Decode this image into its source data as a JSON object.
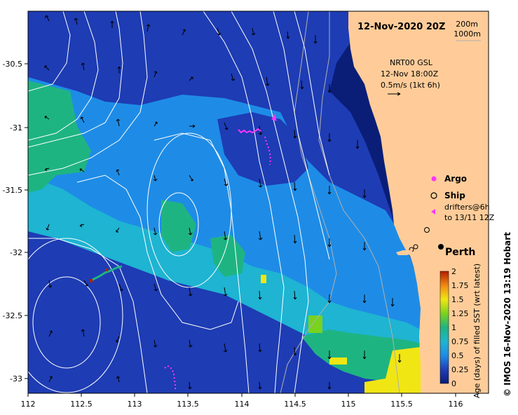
{
  "title": "12-Nov-2020 20Z",
  "contours": {
    "c1": "200m",
    "c2": "1000m"
  },
  "current_info": {
    "line1": "NRT00 GSL",
    "line2": "12-Nov 18:00Z",
    "line3": "0.5m/s (1kt 6h)"
  },
  "legend": {
    "argo": "Argo",
    "ship": "Ship",
    "drifters1": "drifters@6h",
    "drifters2": "to 13/11 12Z"
  },
  "city": "Perth",
  "credit": "© IMOS 16-Nov-2020 13:19 Hobart",
  "colorbar": {
    "label": "Age (days) of filled SST (wrt latest)",
    "ticks": [
      "2",
      "1.75",
      "1.5",
      "1.25",
      "1",
      "0.75",
      "0.5",
      "0.25",
      "0"
    ]
  },
  "x_ticks": [
    "112",
    "112.5",
    "113",
    "113.5",
    "114",
    "114.5",
    "115",
    "115.5",
    "116"
  ],
  "y_ticks": [
    "-30.5",
    "-31",
    "-31.5",
    "-32",
    "-32.5",
    "-33"
  ],
  "colors": {
    "land": "#FFCC99",
    "age_0": "#0A1E78",
    "age_025": "#1E3CB4",
    "age_05": "#1E8CE6",
    "age_075": "#1EB4D2",
    "age_1": "#1EB482",
    "age_125": "#78D21E",
    "age_15": "#F0E614",
    "age_2": "#B41E00"
  }
}
